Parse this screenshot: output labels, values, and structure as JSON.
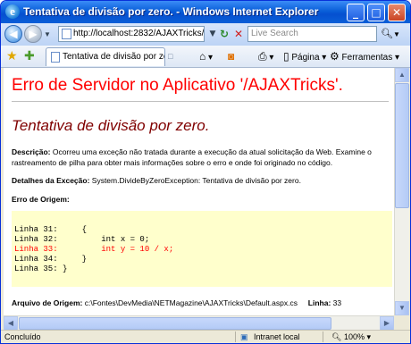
{
  "window": {
    "title": "Tentativa de divisão por zero. - Windows Internet Explorer"
  },
  "address_bar": {
    "url": "http://localhost:2832/AJAXTricks/Def",
    "search_placeholder": "Live Search"
  },
  "tab": {
    "label": "Tentativa de divisão por zero."
  },
  "toolbar": {
    "page_label": "Página",
    "tools_label": "Ferramentas"
  },
  "page": {
    "heading": "Erro de Servidor no Aplicativo '/AJAXTricks'.",
    "error_title": "Tentativa de divisão por zero.",
    "description_label": "Descrição:",
    "description_text": "Ocorreu uma exceção não tratada durante a execução da atual solicitação da Web. Examine o rastreamento de pilha para obter mais informações sobre o erro e onde foi originado no código.",
    "exception_label": "Detalhes da Exceção:",
    "exception_text": "System.DivideByZeroException: Tentativa de divisão por zero.",
    "source_error_label": "Erro de Origem:",
    "code_lines": [
      {
        "text": "Linha 31:     {",
        "error": false
      },
      {
        "text": "Linha 32:         int x = 0;",
        "error": false
      },
      {
        "text": "Linha 33:         int y = 10 / x;",
        "error": true
      },
      {
        "text": "Linha 34:     }",
        "error": false
      },
      {
        "text": "Linha 35: }",
        "error": false
      }
    ],
    "source_file_label": "Arquivo de Origem:",
    "source_file_value": "c:\\Fontes\\DevMedia\\NETMagazine\\AJAXTricks\\Default.aspx.cs",
    "line_label": "Linha:",
    "line_value": "33"
  },
  "status_bar": {
    "status_text": "Concluído",
    "zone_text": "Intranet local",
    "zoom": "100%"
  }
}
